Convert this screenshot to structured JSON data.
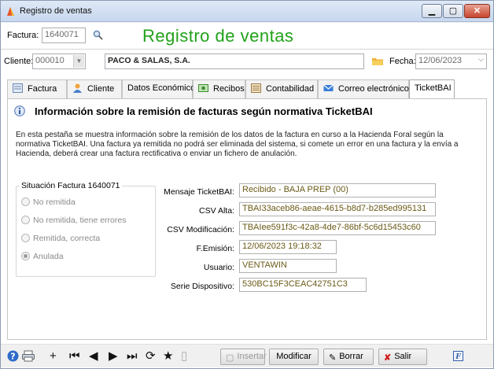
{
  "window": {
    "title": "Registro de ventas"
  },
  "header": {
    "factura_label": "Factura:",
    "factura_value": "1640071",
    "big_title": "Registro de ventas",
    "cliente_label": "Cliente:",
    "cliente_code": "000010",
    "cliente_name": "PACO & SALAS, S.A.",
    "fecha_label": "Fecha:",
    "fecha_value": "12/06/2023"
  },
  "tabs": [
    {
      "label": "Factura"
    },
    {
      "label": "Cliente"
    },
    {
      "label": "Datos Económicos"
    },
    {
      "label": "Recibos"
    },
    {
      "label": "Contabilidad"
    },
    {
      "label": "Correo electrónico"
    },
    {
      "label": "TicketBAI"
    }
  ],
  "panel": {
    "heading": "Información sobre la remisión de facturas según normativa TicketBAI",
    "description": "En esta pestaña se muestra información sobre la remisión de los datos de la factura en curso a la Hacienda Foral según la normativa TicketBAI. Una factura ya remitida no podrá ser eliminada del sistema, si comete un error en una factura y la envía a Hacienda, deberá crear una factura rectificativa o enviar un fichero de anulación.",
    "situacion": {
      "legend": "Situación Factura 1640071",
      "options": [
        "No remitida",
        "No remitida, tiene errores",
        "Remitida, correcta",
        "Anulada"
      ],
      "selected": "Anulada"
    },
    "fields": [
      {
        "label": "Mensaje TicketBAI:",
        "value": "Recibido - BAJA PREP (00)"
      },
      {
        "label": "CSV Alta:",
        "value": "TBAI33aceb86-aeae-4615-b8d7-b285ed995131"
      },
      {
        "label": "CSV Modificación:",
        "value": "TBAIee591f3c-42a8-4de7-86bf-5c6d15453c60"
      },
      {
        "label": "F.Emisión:",
        "value": "12/06/2023 19:18:32"
      },
      {
        "label": "Usuario:",
        "value": "VENTAWIN"
      },
      {
        "label": "Serie Dispositivo:",
        "value": "530BC15F3CEAC42751C3"
      }
    ]
  },
  "toolbar": {
    "insertar": "Insertar",
    "modificar": "Modificar",
    "borrar": "Borrar",
    "salir": "Salir"
  },
  "colors": {
    "title_green": "#21a21a",
    "field_text": "#6a5a16"
  }
}
